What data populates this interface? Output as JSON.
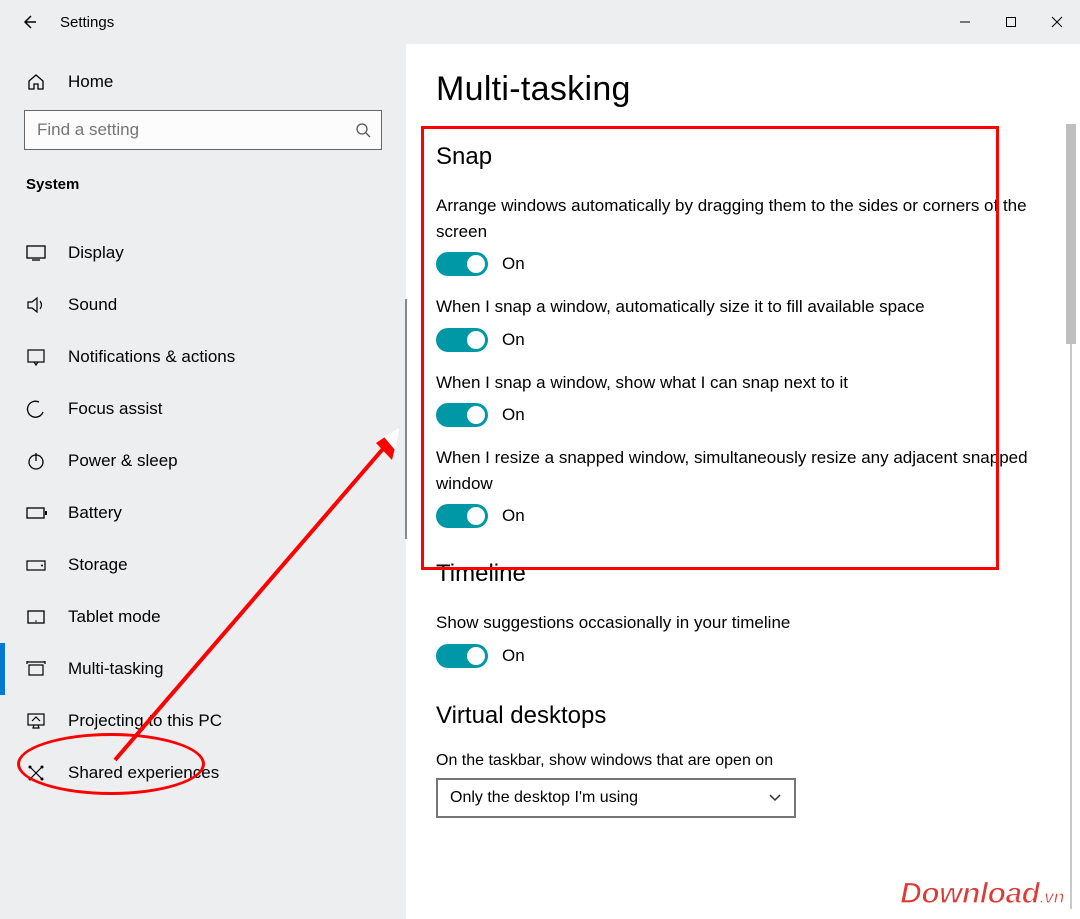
{
  "titlebar": {
    "title": "Settings"
  },
  "sidebar": {
    "home_label": "Home",
    "search_placeholder": "Find a setting",
    "section_label": "System",
    "items": [
      {
        "label": "Display"
      },
      {
        "label": "Sound"
      },
      {
        "label": "Notifications & actions"
      },
      {
        "label": "Focus assist"
      },
      {
        "label": "Power & sleep"
      },
      {
        "label": "Battery"
      },
      {
        "label": "Storage"
      },
      {
        "label": "Tablet mode"
      },
      {
        "label": "Multi-tasking"
      },
      {
        "label": "Projecting to this PC"
      },
      {
        "label": "Shared experiences"
      }
    ]
  },
  "page": {
    "title": "Multi-tasking",
    "snap": {
      "heading": "Snap",
      "s1_desc": "Arrange windows automatically by dragging them to the sides or corners of the screen",
      "s1_state": "On",
      "s2_desc": "When I snap a window, automatically size it to fill available space",
      "s2_state": "On",
      "s3_desc": "When I snap a window, show what I can snap next to it",
      "s3_state": "On",
      "s4_desc": "When I resize a snapped window, simultaneously resize any adjacent snapped window",
      "s4_state": "On"
    },
    "timeline": {
      "heading": "Timeline",
      "desc": "Show suggestions occasionally in your timeline",
      "state": "On"
    },
    "virtual": {
      "heading": "Virtual desktops",
      "desc": "On the taskbar, show windows that are open on",
      "select_value": "Only the desktop I'm using"
    }
  },
  "watermark": {
    "brand": "Download",
    "tld": ".vn"
  },
  "accent_color": "#0098a6"
}
